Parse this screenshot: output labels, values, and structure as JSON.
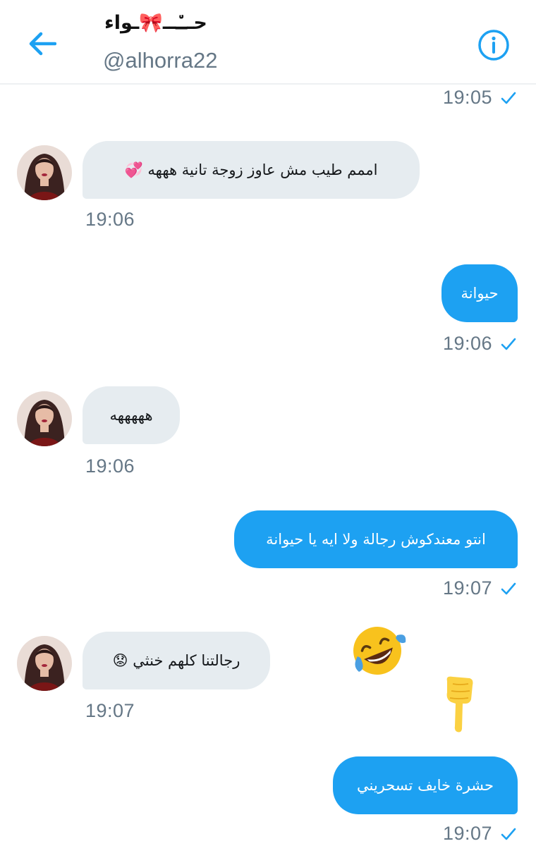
{
  "header": {
    "title": "حــ٘ــ🎀ـواء",
    "handle": "@alhorra22",
    "back_icon": "arrow-left-icon",
    "info_icon": "info-icon",
    "accent": "#1da1f2"
  },
  "messages": [
    {
      "direction": "outgoing",
      "text": "",
      "time": "19:05",
      "read": true
    },
    {
      "direction": "incoming",
      "text": "اممم طيب مش عاوز زوجة تانية هههه 💞",
      "time": "19:06"
    },
    {
      "direction": "outgoing",
      "text": "حيوانة",
      "time": "19:06",
      "read": true
    },
    {
      "direction": "incoming",
      "text": "هههههه",
      "time": "19:06"
    },
    {
      "direction": "outgoing",
      "text": "انتو معندكوش رجالة ولا ايه يا حيوانة",
      "time": "19:07",
      "read": true
    },
    {
      "direction": "incoming",
      "text": "رجالتنا كلهم خنثي 😟",
      "time": "19:07"
    },
    {
      "direction": "outgoing",
      "text": "حشرة خايف تسحريني",
      "time": "19:07",
      "read": true
    }
  ],
  "stickers": [
    {
      "name": "rolling-laughing-emoji"
    },
    {
      "name": "pointing-down-hand-emoji"
    }
  ],
  "colors": {
    "incoming_bubble": "#e6ecf0",
    "outgoing_bubble": "#1da1f2",
    "timestamp": "#657786"
  }
}
